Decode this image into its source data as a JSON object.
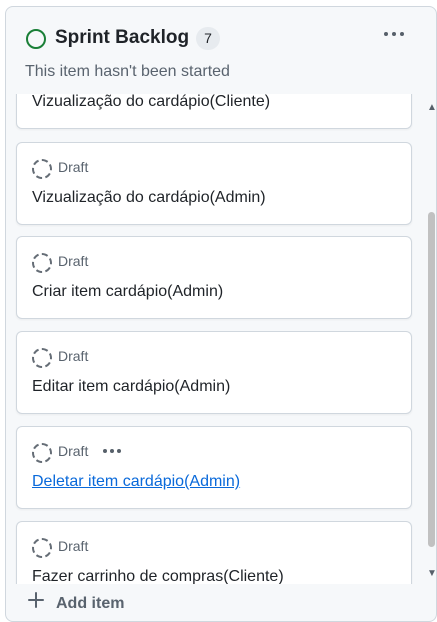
{
  "column": {
    "title": "Sprint Backlog",
    "count": "7",
    "description": "This item hasn't been started",
    "status_icon": "circle-outline-icon",
    "status_color": "#1a7f37",
    "more_icon": "kebab-horizontal-icon"
  },
  "cards": [
    {
      "status": "",
      "title": "Vizualização do cardápio(Cliente)",
      "is_link": false
    },
    {
      "status": "Draft",
      "title": "Vizualização do cardápio(Admin)",
      "is_link": false
    },
    {
      "status": "Draft",
      "title": "Criar item cardápio(Admin)",
      "is_link": false
    },
    {
      "status": "Draft",
      "title": "Editar item cardápio(Admin)",
      "is_link": false
    },
    {
      "status": "Draft",
      "title": "Deletar item cardápio(Admin)",
      "is_link": true
    },
    {
      "status": "Draft",
      "title": "Fazer carrinho de compras(Cliente)",
      "is_link": false
    }
  ],
  "draft_icon": "draft-issue-icon",
  "footer": {
    "add_label": "Add item",
    "add_icon": "plus-icon"
  },
  "colors": {
    "link": "#0969da",
    "muted": "#59636e",
    "border": "#d0d7de"
  }
}
